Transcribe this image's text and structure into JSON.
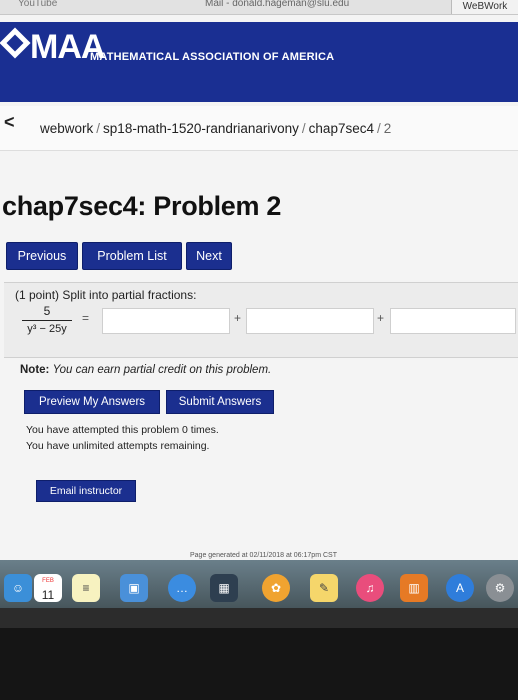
{
  "browser": {
    "left_tab": "YouTube",
    "mid_tab": "Mail - donald.hageman@slu.edu",
    "right_tab": "WeBWork"
  },
  "header": {
    "logo_text": "MAA",
    "org_name": "MATHEMATICAL ASSOCIATION OF AMERICA"
  },
  "breadcrumb": {
    "back": "<",
    "items": [
      "webwork",
      "sp18-math-1520-randrianarivony",
      "chap7sec4",
      "2"
    ]
  },
  "page_title": "chap7sec4: Problem 2",
  "nav": {
    "previous": "Previous",
    "problem_list": "Problem List",
    "next": "Next"
  },
  "problem": {
    "intro": "(1 point) Split into partial fractions:",
    "numerator": "5",
    "denominator": "y³ − 25y",
    "equals": "=",
    "plus": "+",
    "answers": [
      "",
      "",
      ""
    ]
  },
  "note": {
    "label": "Note:",
    "text": "You can earn partial credit on this problem."
  },
  "actions": {
    "preview": "Preview My Answers",
    "submit": "Submit Answers"
  },
  "status": {
    "attempts": "You have attempted this problem 0 times.",
    "remaining": "You have unlimited attempts remaining."
  },
  "email_button": "Email instructor",
  "footer": {
    "generated": "Page generated at 02/11/2018 at 06:17pm CST"
  },
  "dock": {
    "calendar_month": "FEB",
    "calendar_day": "11"
  },
  "colors": {
    "brand_blue": "#1a2f92",
    "button_blue": "#1b2f8f"
  }
}
